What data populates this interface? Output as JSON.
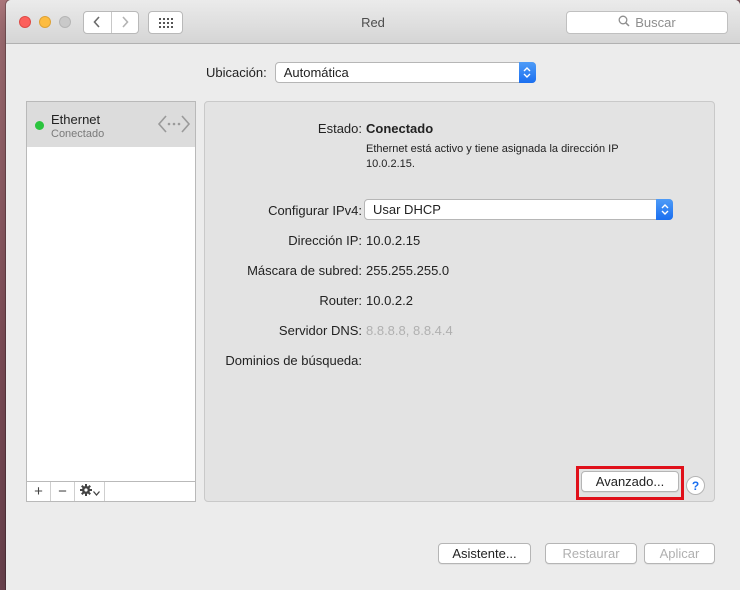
{
  "window": {
    "title": "Red"
  },
  "toolbar": {
    "back_icon": "chevron-left-icon",
    "forward_icon": "chevron-right-icon",
    "show_all_icon": "grid-icon",
    "search_placeholder": "Buscar"
  },
  "location": {
    "label": "Ubicación:",
    "value": "Automática"
  },
  "services": [
    {
      "name": "Ethernet",
      "status": "Conectado",
      "status_color": "#2bc43e",
      "icon": "ethernet-arrows-icon"
    }
  ],
  "service_toolbar": {
    "add": "+",
    "remove": "−",
    "actions_icon": "gear-icon"
  },
  "details": {
    "status_label": "Estado:",
    "status_value": "Conectado",
    "status_desc": "Ethernet está activo y tiene asignada la dirección IP 10.0.2.15.",
    "ipv4_label": "Configurar IPv4:",
    "ipv4_value": "Usar DHCP",
    "ip_label": "Dirección IP:",
    "ip_value": "10.0.2.15",
    "subnet_label": "Máscara de subred:",
    "subnet_value": "255.255.255.0",
    "router_label": "Router:",
    "router_value": "10.0.2.2",
    "dns_label": "Servidor DNS:",
    "dns_value": "8.8.8.8, 8.8.4.4",
    "domains_label": "Dominios de búsqueda:",
    "advanced_button": "Avanzado...",
    "help_button": "?"
  },
  "footer": {
    "assistant": "Asistente...",
    "revert": "Restaurar",
    "apply": "Aplicar"
  },
  "colors": {
    "accent": "#1a6ff0",
    "highlight": "#e0101a"
  }
}
